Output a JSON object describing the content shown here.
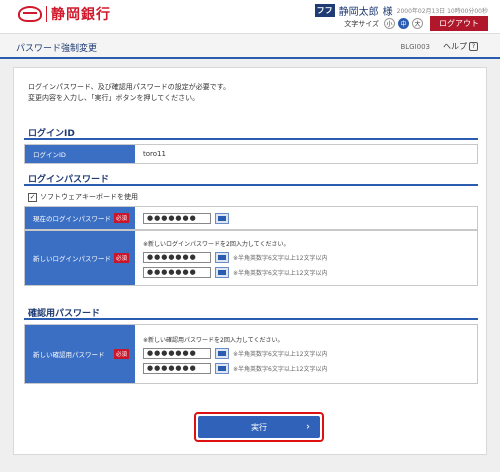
{
  "header": {
    "bank_name": "静岡銀行",
    "user_badge": "フフ",
    "user_name": "静岡太郎",
    "user_suffix": "様",
    "login_time": "2000年02月13日 10時00分00秒",
    "text_size_label": "文字サイズ",
    "size_small": "小",
    "size_medium": "中",
    "size_large": "大",
    "logout_label": "ログアウト"
  },
  "titlebar": {
    "title": "パスワード強制変更",
    "screen_id": "BLGI003",
    "help_label": "ヘルプ",
    "help_icon": "?"
  },
  "intro": {
    "line1": "ログインパスワード、及び確認用パスワードの設定が必要です。",
    "line2": "変更内容を入力し、「実行」ボタンを押してください。"
  },
  "login_id": {
    "section_title": "ログインID",
    "label": "ログインID",
    "value": "toro11"
  },
  "login_password": {
    "section_title": "ログインパスワード",
    "software_keyboard_label": "ソフトウェアキーボードを使用",
    "checkbox_mark": "✓",
    "current_label": "現在のログインパスワード",
    "required": "必須",
    "current_value": "●●●●●●●",
    "new_label": "新しいログインパスワード",
    "new_note": "※新しいログインパスワードを2回入力してください。",
    "new_value_1": "●●●●●●●",
    "new_value_2": "●●●●●●●",
    "hint": "※半角英数字6文字以上12文字以内"
  },
  "confirm_password": {
    "section_title": "確認用パスワード",
    "new_label": "新しい確認用パスワード",
    "required": "必須",
    "new_note": "※新しい確認用パスワードを2回入力してください。",
    "new_value_1": "●●●●●●●",
    "new_value_2": "●●●●●●●",
    "hint": "※半角英数字6文字以上12文字以内"
  },
  "actions": {
    "execute_label": "実行",
    "execute_chevron": "›"
  },
  "colors": {
    "brand_red": "#d1192c",
    "label_blue": "#3b6fc4",
    "button_blue": "#2f62b8",
    "highlight_red": "#dd1111"
  }
}
